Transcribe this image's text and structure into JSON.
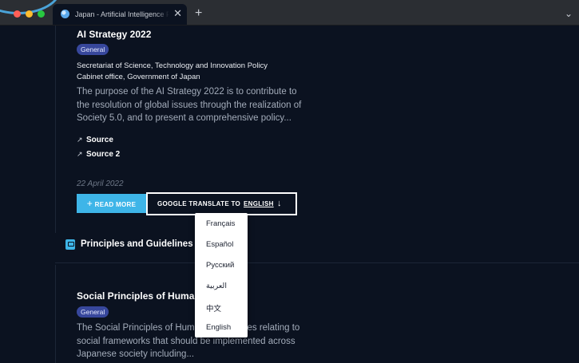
{
  "browser": {
    "tab_title": "Japan - Artificial Intelligence P",
    "close_glyph": "✕",
    "new_tab_glyph": "+",
    "menu_glyph": "⌄"
  },
  "card1": {
    "title": "AI Strategy 2022",
    "badge": "General",
    "org_line1": "Secretariat of Science, Technology and Innovation Policy",
    "org_line2": "Cabinet office, Government of Japan",
    "description": "The purpose of the AI Strategy 2022 is to contribute to the resolution of global issues through the realization of Society 5.0, and to present a comprehensive policy...",
    "links": [
      {
        "label": "Source",
        "icon": "external-link-icon"
      },
      {
        "label": "Source 2",
        "icon": "external-link-icon"
      }
    ],
    "date": "22 April 2022",
    "read_more": "READ MORE",
    "read_more_icon": "+",
    "translate_label": "GOOGLE TRANSLATE TO",
    "translate_lang": "ENGLISH",
    "translate_arrow": "↓"
  },
  "section": {
    "title": "Principles and Guidelines",
    "icon": "book-icon"
  },
  "card2": {
    "title": "Social Principles of Human-",
    "badge": "General",
    "description": "The Social Principles of Huma        are principles relating to social frameworks that should be implemented across Japanese society including..."
  },
  "language_dropdown": {
    "options": [
      "Français",
      "Español",
      "Русский",
      "العربية",
      "中文",
      "English"
    ]
  },
  "colors": {
    "background": "#0b1220",
    "accent": "#3eb5e8",
    "badge": "#37479c"
  }
}
